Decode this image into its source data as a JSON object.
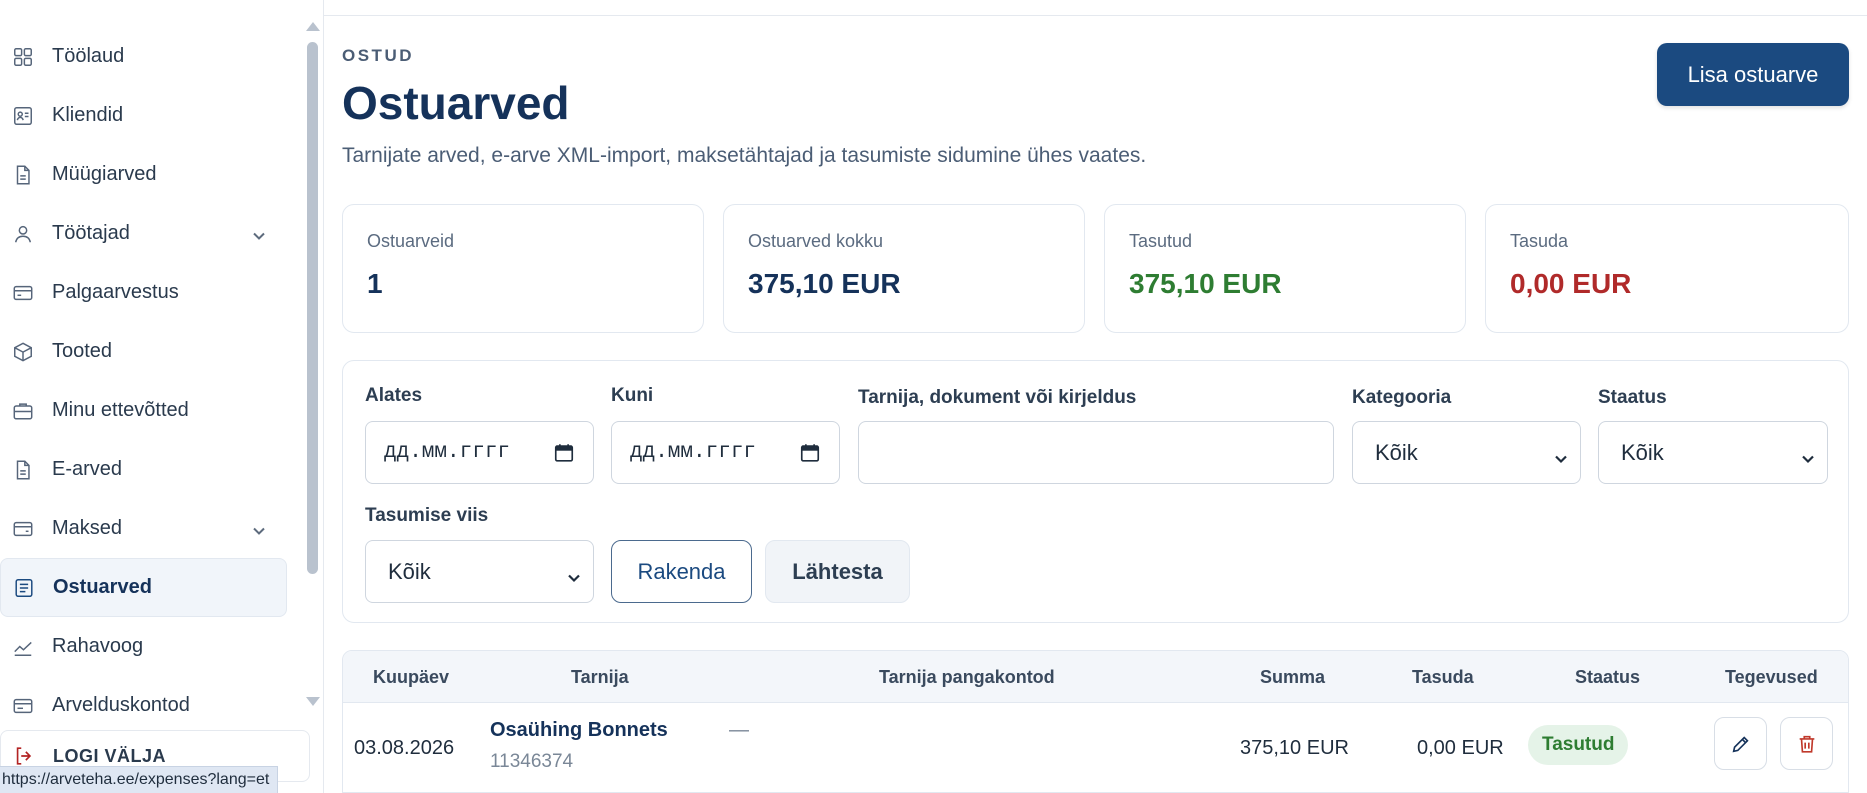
{
  "sidebar": {
    "items": [
      {
        "label": "Töölaud",
        "icon": "dashboard-icon",
        "expandable": false
      },
      {
        "label": "Kliendid",
        "icon": "contacts-icon",
        "expandable": false
      },
      {
        "label": "Müügiarved",
        "icon": "document-icon",
        "expandable": false
      },
      {
        "label": "Töötajad",
        "icon": "user-icon",
        "expandable": true
      },
      {
        "label": "Palgaarvestus",
        "icon": "card-icon",
        "expandable": false
      },
      {
        "label": "Tooted",
        "icon": "box-icon",
        "expandable": false
      },
      {
        "label": "Minu ettevõtted",
        "icon": "briefcase-icon",
        "expandable": false
      },
      {
        "label": "E-arved",
        "icon": "document-icon",
        "expandable": false
      },
      {
        "label": "Maksed",
        "icon": "wallet-icon",
        "expandable": true
      },
      {
        "label": "Ostuarved",
        "icon": "list-document-icon",
        "expandable": false,
        "active": true
      },
      {
        "label": "Rahavoog",
        "icon": "chart-line-icon",
        "expandable": false
      },
      {
        "label": "Arvelduskontod",
        "icon": "bank-card-icon",
        "expandable": false
      }
    ],
    "logout_label": "LOGI VÄLJA"
  },
  "statusbar": {
    "url": "https://arveteha.ee/expenses?lang=et"
  },
  "header": {
    "eyebrow": "OSTUD",
    "title": "Ostuarved",
    "subtitle": "Tarnijate arved, e-arve XML-import, maksetähtajad ja tasumiste sidumine ühes vaates.",
    "add_button": "Lisa ostuarve"
  },
  "stats": [
    {
      "label": "Ostuarveid",
      "value": "1",
      "tone": "default"
    },
    {
      "label": "Ostuarved kokku",
      "value": "375,10 EUR",
      "tone": "default"
    },
    {
      "label": "Tasutud",
      "value": "375,10 EUR",
      "tone": "green"
    },
    {
      "label": "Tasuda",
      "value": "0,00 EUR",
      "tone": "red"
    }
  ],
  "filters": {
    "from_label": "Alates",
    "from_placeholder": "дд.мм.гггг",
    "to_label": "Kuni",
    "to_placeholder": "дд.мм.гггг",
    "search_label": "Tarnija, dokument või kirjeldus",
    "search_value": "",
    "category_label": "Kategooria",
    "category_value": "Kõik",
    "status_label": "Staatus",
    "status_value": "Kõik",
    "payment_label": "Tasumise viis",
    "payment_value": "Kõik",
    "apply_label": "Rakenda",
    "reset_label": "Lähtesta"
  },
  "table": {
    "columns": [
      "Kuupäev",
      "Tarnija",
      "Tarnija pangakontod",
      "Summa",
      "Tasuda",
      "Staatus",
      "Tegevused"
    ],
    "rows": [
      {
        "date": "03.08.2026",
        "supplier": "Osaühing Bonnets",
        "supplier_code": "11346374",
        "bank_accounts": "—",
        "amount": "375,10 EUR",
        "to_pay": "0,00 EUR",
        "status": "Tasutud"
      }
    ]
  },
  "colors": {
    "accent": "#1b4a80",
    "title": "#15325a",
    "paid_green": "#2e7d32",
    "due_red": "#b02a2a",
    "delete_red": "#c0392b"
  }
}
